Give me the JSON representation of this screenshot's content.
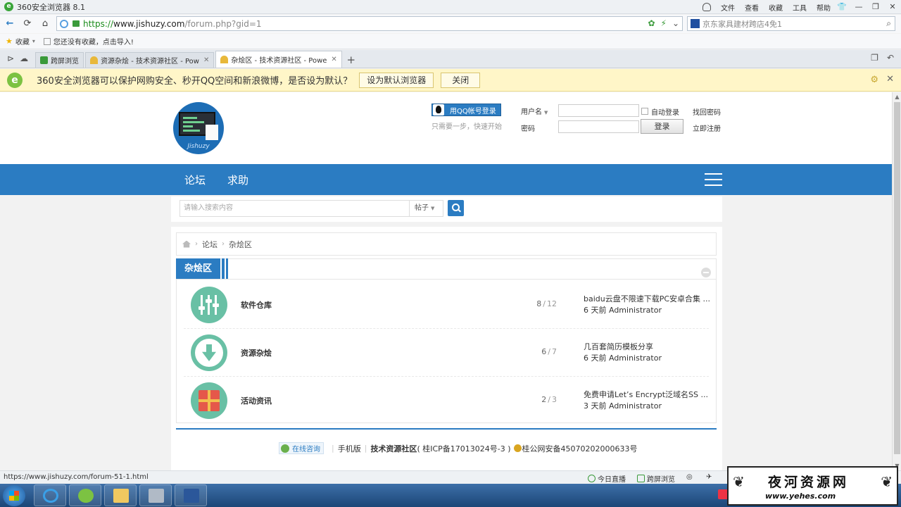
{
  "window": {
    "title": "360安全浏览器 8.1",
    "menu": [
      "文件",
      "查看",
      "收藏",
      "工具",
      "帮助"
    ],
    "controls": [
      "shirt-icon",
      "minimize-icon",
      "maximize-icon",
      "close-icon"
    ]
  },
  "address": {
    "scheme": "https://",
    "host": "www.jishuzy.com",
    "path": "/forum.php?gid=1",
    "search_placeholder": "京东家具建材跨店4免1"
  },
  "bookmarks": {
    "fav_label": "收藏",
    "import_hint": "您还没有收藏，点击导入!"
  },
  "tabs": [
    {
      "label": "跨屏浏览",
      "active": false
    },
    {
      "label": "资源杂烩 - 技术资源社区 - Pow",
      "active": false
    },
    {
      "label": "杂烩区 - 技术资源社区 - Powe",
      "active": true
    }
  ],
  "notification": {
    "message": "360安全浏览器可以保护网购安全、秒开QQ空间和新浪微博，是否设为默认？",
    "set_default": "设为默认浏览器",
    "close": "关闭"
  },
  "header": {
    "logo_text": "Jishuzy",
    "qq_login": "用QQ帐号登录",
    "qq_tip": "只需要一步，快速开始",
    "username_label": "用户名",
    "password_label": "密码",
    "auto_login": "自动登录",
    "login_button": "登录",
    "forgot_password": "找回密码",
    "register": "立即注册"
  },
  "nav": {
    "items": [
      "论坛",
      "求助"
    ]
  },
  "search": {
    "placeholder": "请输入搜索内容",
    "type": "帖子"
  },
  "breadcrumb": [
    "论坛",
    "杂烩区"
  ],
  "section": {
    "title": "杂烩区",
    "forums": [
      {
        "name": "软件仓库",
        "topics": "8",
        "posts": "12",
        "last_title": "baidu云盘不限速下载PC安卓合集 ...",
        "last_meta": "6 天前 Administrator",
        "icon": "sliders-icon"
      },
      {
        "name": "资源杂烩",
        "topics": "6",
        "posts": "7",
        "last_title": "几百套简历模板分享",
        "last_meta": "6 天前 Administrator",
        "icon": "download-arrow-icon"
      },
      {
        "name": "活动资讯",
        "topics": "2",
        "posts": "3",
        "last_title": "免费申请Let’s Encrypt泛域名SS ...",
        "last_meta": "3 天前 Administrator",
        "icon": "gift-box-icon"
      }
    ]
  },
  "footer": {
    "consult": "在线咨询",
    "mobile": "手机版",
    "site_name": "技术资源社区",
    "icp": "( 桂ICP备17013024号-3 )",
    "police": "桂公网安备45070202000633号"
  },
  "statusbar": {
    "url": "https://www.jishuzy.com/forum-51-1.html",
    "today_live": "今日直播",
    "cross_screen": "跨屏浏览"
  },
  "watermark": {
    "title": "夜河资源网",
    "url": "www.yehes.com"
  }
}
